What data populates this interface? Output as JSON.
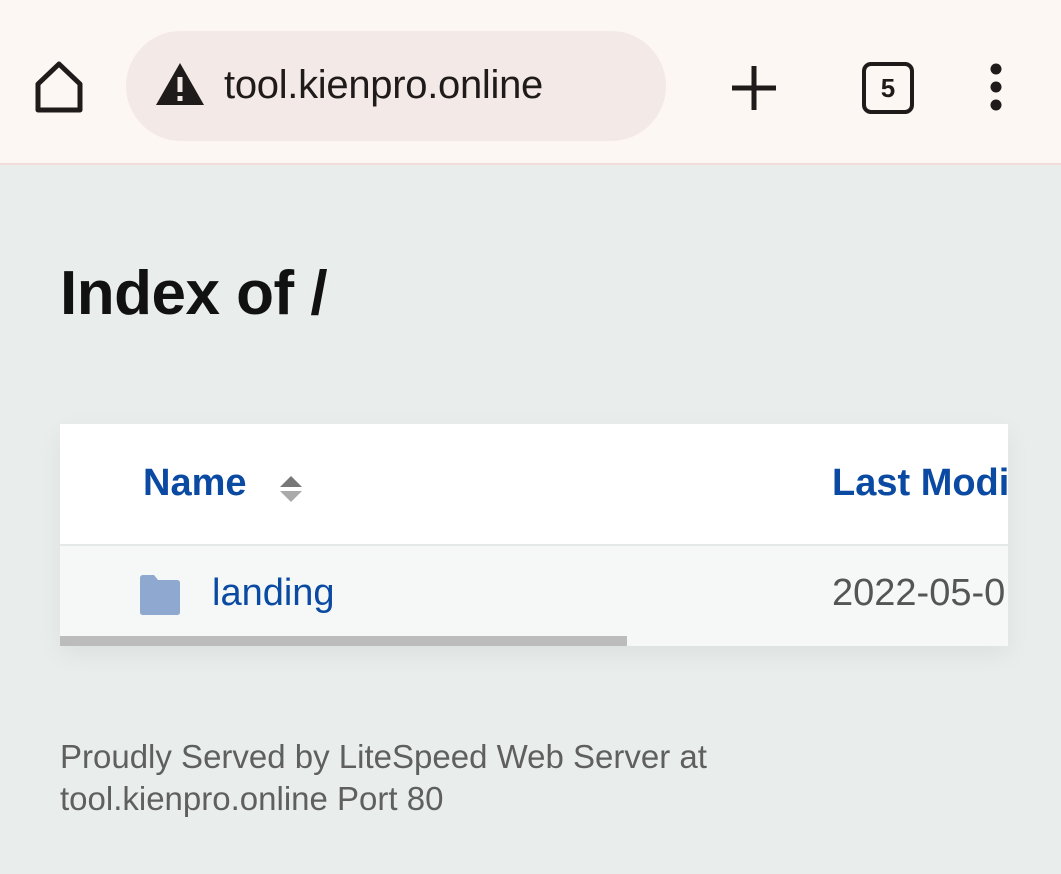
{
  "browser": {
    "url": "tool.kienpro.online",
    "tab_count": "5",
    "icons": {
      "home": "home-icon",
      "security": "warning-triangle-icon",
      "new_tab": "plus-icon",
      "menu": "vertical-dots-icon"
    }
  },
  "page": {
    "title": "Index of /",
    "columns": {
      "name": "Name",
      "last_modified": "Last Modif"
    },
    "entries": [
      {
        "name": "landing",
        "last_modified": "2022-05-0",
        "type": "folder"
      }
    ],
    "footer": {
      "line1": "Proudly Served by LiteSpeed Web Server at",
      "line2": "tool.kienpro.online Port 80"
    }
  },
  "colors": {
    "link": "#0b4aa2",
    "page_background": "#e9eeed",
    "toolbar_background": "#fdf7f4",
    "omnibox_background": "#f3e9e7",
    "folder_icon": "#8ea8cf"
  }
}
